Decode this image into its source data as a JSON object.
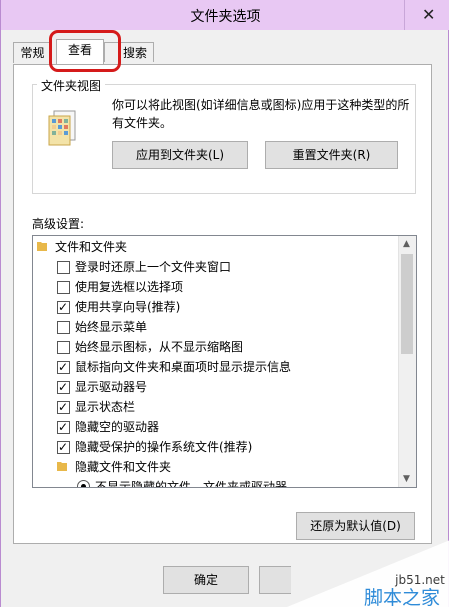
{
  "window": {
    "title": "文件夹选项",
    "close_glyph": "✕"
  },
  "tabs": [
    {
      "label": "常规"
    },
    {
      "label": "查看"
    },
    {
      "label": "搜索"
    }
  ],
  "folder_views": {
    "group_label": "文件夹视图",
    "description": "你可以将此视图(如详细信息或图标)应用于这种类型的所有文件夹。",
    "apply_button": "应用到文件夹(L)",
    "reset_button": "重置文件夹(R)"
  },
  "advanced": {
    "label": "高级设置:",
    "root": "文件和文件夹",
    "items": [
      {
        "label": "登录时还原上一个文件夹窗口",
        "checked": false
      },
      {
        "label": "使用复选框以选择项",
        "checked": false
      },
      {
        "label": "使用共享向导(推荐)",
        "checked": true
      },
      {
        "label": "始终显示菜单",
        "checked": false
      },
      {
        "label": "始终显示图标，从不显示缩略图",
        "checked": false
      },
      {
        "label": "鼠标指向文件夹和桌面项时显示提示信息",
        "checked": true
      },
      {
        "label": "显示驱动器号",
        "checked": true
      },
      {
        "label": "显示状态栏",
        "checked": true
      },
      {
        "label": "隐藏空的驱动器",
        "checked": true
      },
      {
        "label": "隐藏受保护的操作系统文件(推荐)",
        "checked": true
      }
    ],
    "subfolder": "隐藏文件和文件夹",
    "radio_option": "不显示隐藏的文件、文件夹或驱动器",
    "restore_button": "还原为默认值(D)"
  },
  "footer": {
    "ok_button": "确定"
  },
  "watermark": {
    "site": "jb51.net",
    "brand": "脚本之家"
  },
  "colors": {
    "title_bar": "#e8c8f3",
    "highlight": "#d51a1a",
    "folder": "#e8b84a"
  }
}
